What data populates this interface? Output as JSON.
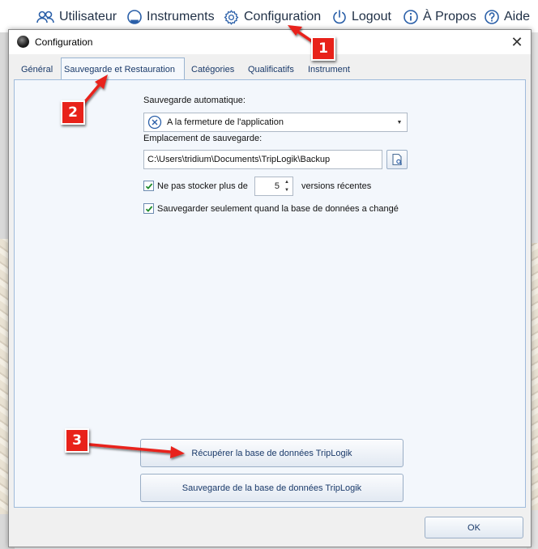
{
  "menu": {
    "user": "Utilisateur",
    "instruments": "Instruments",
    "configuration": "Configuration",
    "logout": "Logout",
    "about": "À Propos",
    "help": "Aide"
  },
  "dialog": {
    "title": "Configuration",
    "close_glyph": "✕"
  },
  "tabs": [
    {
      "label": "Général"
    },
    {
      "label": "Sauvegarde et Restauration"
    },
    {
      "label": "Catégories"
    },
    {
      "label": "Qualificatifs"
    },
    {
      "label": "Instrument"
    }
  ],
  "active_tab": "Sauvegarde et Restauration",
  "backup": {
    "auto_label": "Sauvegarde automatique:",
    "auto_value": "A la fermeture de l'application",
    "location_label": "Emplacement de sauvegarde:",
    "location_value": "C:\\Users\\tridium\\Documents\\TripLogik\\Backup",
    "limit_prefix": "Ne pas stocker plus de",
    "limit_value": "5",
    "limit_suffix": "versions récentes",
    "limit_checked": true,
    "only_changed_label": "Sauvegarder seulement quand la base de données a changé",
    "only_changed_checked": true
  },
  "actions": {
    "restore_label": "Récupérer la base de données TripLogik",
    "backup_label": "Sauvegarde de la base de données TripLogik",
    "ok_label": "OK"
  },
  "annotations": [
    "1",
    "2",
    "3"
  ],
  "colors": {
    "annotation_red": "#e8221a",
    "accent_blue": "#1a3a6a",
    "panel_border": "#9fbbdb"
  }
}
